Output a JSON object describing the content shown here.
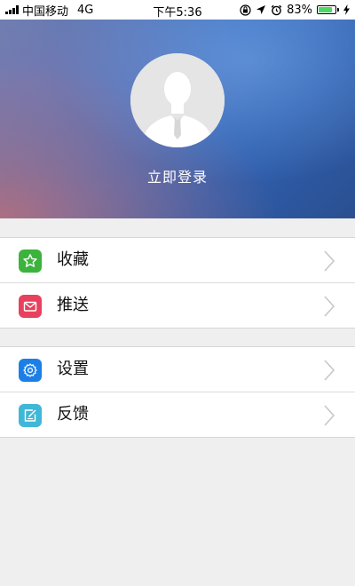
{
  "status_bar": {
    "carrier": "中国移动",
    "network": "4G",
    "time": "下午5:36",
    "battery_percent": "83%",
    "battery_level": 0.83
  },
  "header": {
    "login_label": "立即登录"
  },
  "menu": {
    "group1": [
      {
        "label": "收藏",
        "icon": "star-icon",
        "color": "#3cb33c"
      },
      {
        "label": "推送",
        "icon": "mail-icon",
        "color": "#e8415d"
      }
    ],
    "group2": [
      {
        "label": "设置",
        "icon": "gear-icon",
        "color": "#1d7fe6"
      },
      {
        "label": "反馈",
        "icon": "edit-icon",
        "color": "#3fb7d6"
      }
    ]
  }
}
